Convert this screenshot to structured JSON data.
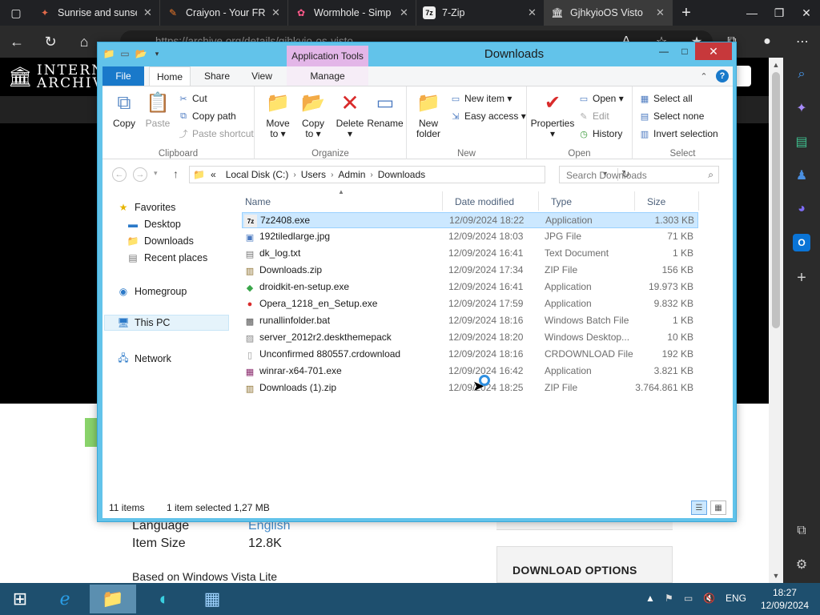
{
  "browser": {
    "tabs": [
      {
        "label": "Sunrise and sunse",
        "icon": "sunrise-favicon-icon",
        "active": false
      },
      {
        "label": "Craiyon - Your FR",
        "icon": "craiyon-favicon-icon",
        "active": false
      },
      {
        "label": "Wormhole - Simp",
        "icon": "wormhole-favicon-icon",
        "active": false
      },
      {
        "label": "7-Zip",
        "icon": "7zip-favicon-icon",
        "active": false
      },
      {
        "label": "GjhkyioOS Visto",
        "icon": "archive-favicon-icon",
        "active": true
      }
    ],
    "url": "https://archive.org/details/gjhkyio-os-visto",
    "new_tab_glyph": "+",
    "colors": {
      "dark": "#202124",
      "accent": "#1979ca"
    }
  },
  "archive_page": {
    "logo_line1": "INTERN",
    "logo_line2": "ARCHIVE",
    "language_label": "Language",
    "language_value": "English",
    "item_size_label": "Item Size",
    "item_size_value": "12.8K",
    "based_on": "Based on Windows Vista Lite",
    "download_options": "DOWNLOAD OPTIONS"
  },
  "explorer": {
    "title": "Downloads",
    "app_tools_label": "Application Tools",
    "ribbon_tabs": {
      "file": "File",
      "home": "Home",
      "share": "Share",
      "view": "View",
      "manage": "Manage"
    },
    "clipboard": {
      "label": "Clipboard",
      "copy": "Copy",
      "paste": "Paste",
      "cut": "Cut",
      "copy_path": "Copy path",
      "paste_shortcut": "Paste shortcut"
    },
    "organize": {
      "label": "Organize",
      "move_to_1": "Move",
      "move_to_2": "to ▾",
      "copy_to_1": "Copy",
      "copy_to_2": "to ▾",
      "delete_1": "Delete",
      "delete_2": "▾",
      "rename": "Rename"
    },
    "new": {
      "label": "New",
      "new_folder_1": "New",
      "new_folder_2": "folder",
      "new_item": "New item ▾",
      "easy_access": "Easy access ▾"
    },
    "open": {
      "label": "Open",
      "properties_1": "Properties",
      "properties_2": "▾",
      "open": "Open ▾",
      "edit": "Edit",
      "history": "History"
    },
    "select": {
      "label": "Select",
      "select_all": "Select all",
      "select_none": "Select none",
      "invert": "Invert selection"
    },
    "address": {
      "prefix": "«",
      "crumbs": [
        "Local Disk (C:)",
        "Users",
        "Admin",
        "Downloads"
      ]
    },
    "search_placeholder": "Search Downloads",
    "nav": {
      "favorites": "Favorites",
      "desktop": "Desktop",
      "downloads": "Downloads",
      "recent": "Recent places",
      "homegroup": "Homegroup",
      "this_pc": "This PC",
      "network": "Network"
    },
    "columns": {
      "name": "Name",
      "date": "Date modified",
      "type": "Type",
      "size": "Size"
    },
    "files": [
      {
        "name": "7z2408.exe",
        "date": "12/09/2024 18:22",
        "type": "Application",
        "size": "1.303 KB",
        "icon": "7zip-exe-icon",
        "selected": true
      },
      {
        "name": "192tiledlarge.jpg",
        "date": "12/09/2024 18:03",
        "type": "JPG File",
        "size": "71 KB",
        "icon": "image-file-icon",
        "selected": false
      },
      {
        "name": "dk_log.txt",
        "date": "12/09/2024 16:41",
        "type": "Text Document",
        "size": "1 KB",
        "icon": "text-file-icon",
        "selected": false
      },
      {
        "name": "Downloads.zip",
        "date": "12/09/2024 17:34",
        "type": "ZIP File",
        "size": "156 KB",
        "icon": "zip-file-icon",
        "selected": false
      },
      {
        "name": "droidkit-en-setup.exe",
        "date": "12/09/2024 16:41",
        "type": "Application",
        "size": "19.973 KB",
        "icon": "droidkit-exe-icon",
        "selected": false
      },
      {
        "name": "Opera_1218_en_Setup.exe",
        "date": "12/09/2024 17:59",
        "type": "Application",
        "size": "9.832 KB",
        "icon": "opera-exe-icon",
        "selected": false
      },
      {
        "name": "runallinfolder.bat",
        "date": "12/09/2024 18:16",
        "type": "Windows Batch File",
        "size": "1 KB",
        "icon": "batch-file-icon",
        "selected": false
      },
      {
        "name": "server_2012r2.deskthemepack",
        "date": "12/09/2024 18:20",
        "type": "Windows Desktop...",
        "size": "10 KB",
        "icon": "themepack-file-icon",
        "selected": false
      },
      {
        "name": "Unconfirmed 880557.crdownload",
        "date": "12/09/2024 18:16",
        "type": "CRDOWNLOAD File",
        "size": "192 KB",
        "icon": "blank-file-icon",
        "selected": false
      },
      {
        "name": "winrar-x64-701.exe",
        "date": "12/09/2024 16:42",
        "type": "Application",
        "size": "3.821 KB",
        "icon": "winrar-exe-icon",
        "selected": false
      },
      {
        "name": "Downloads (1).zip",
        "date": "12/09/2024 18:25",
        "type": "ZIP File",
        "size": "3.764.861 KB",
        "icon": "zip-file-icon",
        "selected": false
      }
    ],
    "status": {
      "items": "11 items",
      "selected": "1 item selected  1,27 MB"
    }
  },
  "taskbar": {
    "language": "ENG",
    "time": "18:27",
    "date": "12/09/2024"
  }
}
